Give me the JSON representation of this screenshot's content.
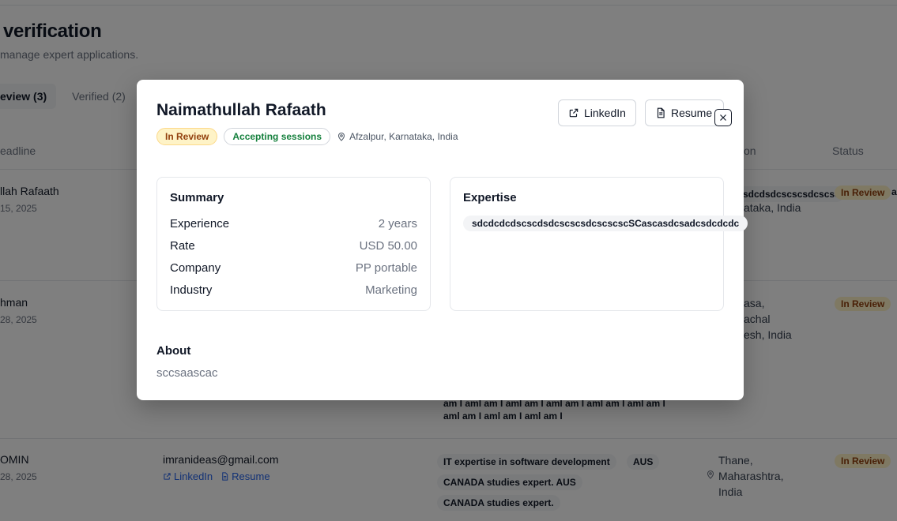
{
  "page": {
    "title": "verification",
    "subtitle": "manage expert applications.",
    "tabs": [
      {
        "label": "eview (3)"
      },
      {
        "label": "Verified (2)"
      }
    ],
    "columns": {
      "headline": "eadline",
      "location": "on",
      "status": "Status"
    },
    "rows": [
      {
        "name": "llah Rafaath",
        "date": "15, 2025",
        "expertise": "sdcdsdcscscsdcscscsc",
        "location": "ataka, India",
        "status": "In Review",
        "extra": "a"
      },
      {
        "name": "hman",
        "date": "28, 2025",
        "location_lines": [
          "asa,",
          "achal",
          "esh, India"
        ],
        "expertise_lines": [
          "am I aml am I aml am I aml am I aml am I aml am I",
          "aml am I aml am I aml am I"
        ],
        "status": "In Review"
      },
      {
        "name": "OMIN",
        "date": "28, 2025",
        "email": "imranideas@gmail.com",
        "linkedin": "LinkedIn",
        "resume": "Resume",
        "chips": [
          "IT expertise in software development",
          "AUS",
          "CANADA studies expert. AUS",
          "CANADA studies expert."
        ],
        "location_lines": [
          "Thane,",
          "Maharashtra,",
          "India"
        ],
        "status": "In Review"
      }
    ]
  },
  "modal": {
    "name": "Naimathullah Rafaath",
    "status_badge": "In Review",
    "availability_badge": "Accepting sessions",
    "location": "Afzalpur, Karnataka, India",
    "linkedin_label": "LinkedIn",
    "resume_label": "Resume",
    "summary": {
      "title": "Summary",
      "items": [
        {
          "label": "Experience",
          "value": "2 years"
        },
        {
          "label": "Rate",
          "value": "USD 50.00"
        },
        {
          "label": "Company",
          "value": "PP portable"
        },
        {
          "label": "Industry",
          "value": "Marketing"
        }
      ]
    },
    "expertise": {
      "title": "Expertise",
      "chip": "sdcdcdcdscscdsdcscscsdcscscscSCascasdcsadcsdcdcdc"
    },
    "about": {
      "title": "About",
      "text": "sccsaascac"
    }
  },
  "colors": {
    "overlay": "#00000080",
    "review_bg": "#fef3c7",
    "review_text": "#92400e",
    "accepting_text": "#15803d",
    "link": "#2563eb"
  },
  "icons": [
    "external-link-icon",
    "document-icon",
    "close-icon",
    "map-pin-icon"
  ]
}
